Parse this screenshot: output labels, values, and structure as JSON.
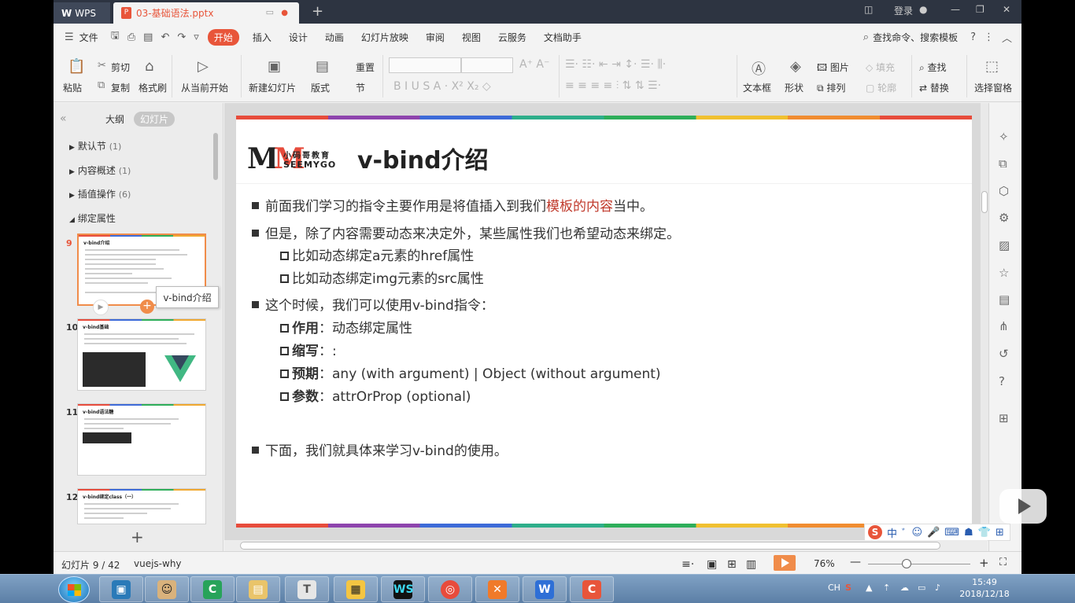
{
  "titlebar": {
    "app_name": "WPS",
    "doc_tab": "03-基础语法.pptx",
    "new_tab": "+",
    "login": "登录"
  },
  "menubar": {
    "file": "文件",
    "items": [
      "开始",
      "插入",
      "设计",
      "动画",
      "幻灯片放映",
      "审阅",
      "视图",
      "云服务",
      "文档助手"
    ],
    "search": "查找命令、搜索模板"
  },
  "ribbon": {
    "paste": "粘贴",
    "cut": "剪切",
    "copy": "复制",
    "format_painter": "格式刷",
    "from_current": "从当前开始",
    "new_slide": "新建幻灯片",
    "layout": "版式",
    "reset": "重置",
    "section": "节",
    "textbox": "文本框",
    "shape": "形状",
    "picture": "图片",
    "arrange": "排列",
    "fill": "填充",
    "outline": "轮廓",
    "find": "查找",
    "replace": "替换",
    "select_pane": "选择窗格"
  },
  "leftpanel": {
    "tab_outline": "大纲",
    "tab_slides": "幻灯片",
    "sections": [
      {
        "label": "默认节",
        "count": "(1)"
      },
      {
        "label": "内容概述",
        "count": "(1)"
      },
      {
        "label": "插值操作",
        "count": "(6)"
      },
      {
        "label": "绑定属性",
        "count": ""
      }
    ],
    "thumbs": [
      {
        "num": "9",
        "title": "v-bind介绍"
      },
      {
        "num": "10",
        "title": "v-bind基础"
      },
      {
        "num": "11",
        "title": "v-bind语法糖"
      },
      {
        "num": "12",
        "title": "v-bind绑定class（一）"
      }
    ],
    "tooltip": "v-bind介绍",
    "add": "+"
  },
  "slide": {
    "logo_cn": "小码哥教育",
    "logo_en": "SEEMYGO",
    "title": "v-bind介绍",
    "b1_pre": "前面我们学习的指令主要作用是将值插入到我们",
    "b1_hl": "模板的内容",
    "b1_post": "当中。",
    "b2": "但是，除了内容需要动态来决定外，某些属性我们也希望动态来绑定。",
    "b2_sub1": "比如动态绑定a元素的href属性",
    "b2_sub2": "比如动态绑定img元素的src属性",
    "b3": "这个时候，我们可以使用v-bind指令：",
    "s_label1": "作用",
    "s_val1": "：动态绑定属性",
    "s_label2": "缩写",
    "s_val2": "：:",
    "s_label3": "预期",
    "s_val3": "：any (with argument) | Object (without argument)",
    "s_label4": "参数",
    "s_val4": "：attrOrProp (optional)",
    "b4": "下面，我们就具体来学习v-bind的使用。"
  },
  "statusbar": {
    "slide_info": "幻灯片 9 / 42",
    "theme": "vuejs-why",
    "zoom": "76%"
  },
  "ime": {
    "s": "S",
    "mode": "中"
  },
  "taskbar": {
    "time": "15:49",
    "date": "2018/12/18",
    "lang": "CH"
  }
}
